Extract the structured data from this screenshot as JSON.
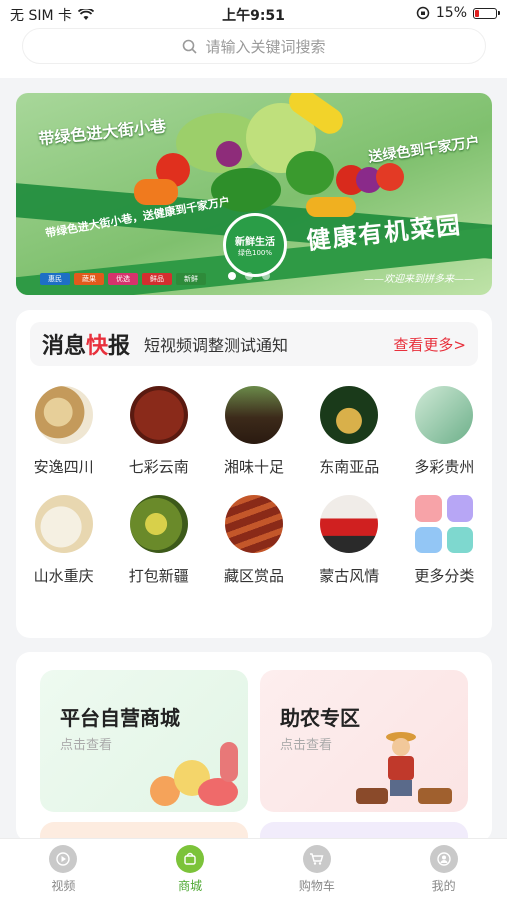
{
  "status_bar": {
    "carrier": "无 SIM 卡",
    "time": "上午9:51",
    "battery": "15%"
  },
  "search": {
    "placeholder": "请输入关键词搜索"
  },
  "banner": {
    "slogan_left": "带绿色进大街小巷",
    "slogan_right": "送绿色到千家万户",
    "slogan_band": "带绿色进大街小巷，送健康到千家万户",
    "brand": "健康有机菜园",
    "seal_main": "新鲜生活",
    "seal_sub": "绿色100%",
    "welcome": "——欢迎来到拼多来——",
    "logos": [
      "惠民",
      "蔬果",
      "优选",
      "鲜品",
      "新鲜"
    ]
  },
  "news": {
    "title_plain": "消息",
    "title_highlight": "快",
    "title_end": "报",
    "text": "短视频调整测试通知",
    "more": "查看更多>"
  },
  "categories": [
    {
      "label": "安逸四川"
    },
    {
      "label": "七彩云南"
    },
    {
      "label": "湘味十足"
    },
    {
      "label": "东南亚品"
    },
    {
      "label": "多彩贵州"
    },
    {
      "label": "山水重庆"
    },
    {
      "label": "打包新疆"
    },
    {
      "label": "藏区赏品"
    },
    {
      "label": "蒙古风情"
    },
    {
      "label": "更多分类"
    }
  ],
  "mall": {
    "self_title": "平台自营商城",
    "self_sub": "点击查看",
    "farm_title": "助农专区",
    "farm_sub": "点击查看"
  },
  "tabbar": [
    {
      "label": "视频",
      "icon": "play-icon"
    },
    {
      "label": "商城",
      "icon": "shop-bag-icon"
    },
    {
      "label": "购物车",
      "icon": "cart-icon"
    },
    {
      "label": "我的",
      "icon": "user-icon"
    }
  ],
  "colors": {
    "accent": "#e8303c",
    "brand_green": "#7cc33a"
  }
}
